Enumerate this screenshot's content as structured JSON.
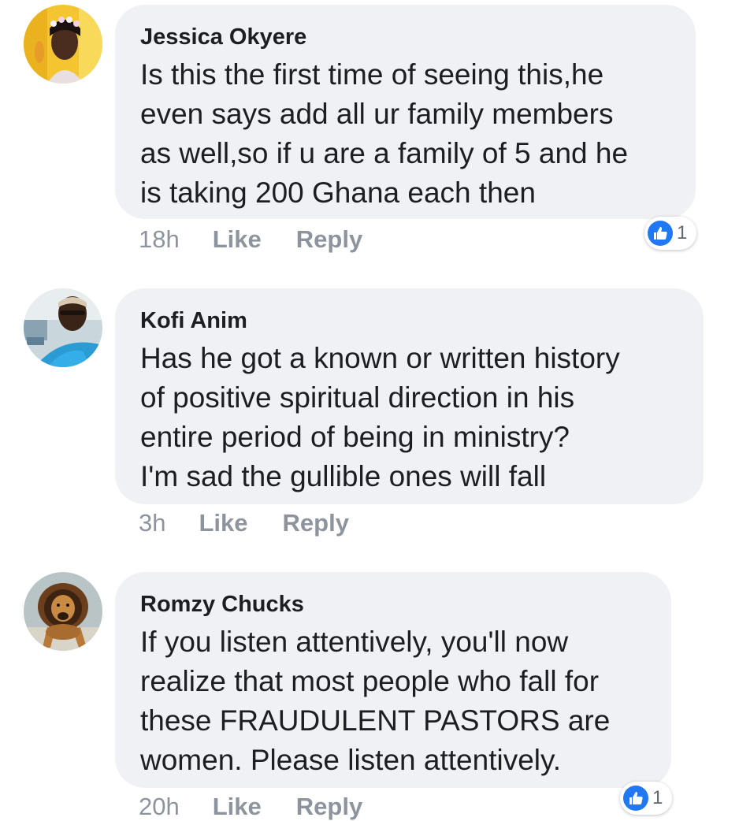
{
  "colors": {
    "bubble_bg": "#f0f1f4",
    "meta_text": "#8d949e",
    "like_blue": "#2078f4"
  },
  "comments": [
    {
      "author": "Jessica Okyere",
      "text": "Is this the first time of seeing this,he\neven says add all ur family members\nas well,so if u are a family of 5 and he\nis taking 200 Ghana each then",
      "time": "18h",
      "like_label": "Like",
      "reply_label": "Reply",
      "reaction_count": "1",
      "avatar_icon": "profile-photo"
    },
    {
      "author": "Kofi Anim",
      "text": "Has  he got a known or written history\nof positive spiritual direction in his\nentire period  of being in ministry?\nI'm sad the gullible ones will fall",
      "time": "3h",
      "like_label": "Like",
      "reply_label": "Reply",
      "avatar_icon": "profile-photo"
    },
    {
      "author": "Romzy Chucks",
      "text": "If you listen attentively, you'll now\nrealize that most people who fall for\nthese FRAUDULENT PASTORS are\nwomen. Please listen attentively.",
      "time": "20h",
      "like_label": "Like",
      "reply_label": "Reply",
      "reaction_count": "1",
      "avatar_icon": "lion-photo"
    }
  ]
}
